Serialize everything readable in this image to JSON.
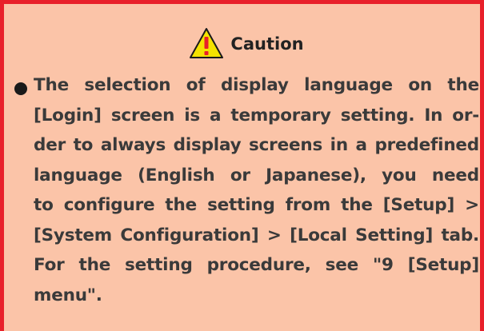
{
  "caution": {
    "title": "Caution",
    "icon": "warning-triangle-icon",
    "colors": {
      "border": "#e8202a",
      "background": "#fbc4a8",
      "icon_fill": "#f4e200",
      "text": "#3a3a3a"
    },
    "body_lines": [
      "The selection of display language on the",
      "[Login] screen is a temporary setting. In or-",
      "der to always display screens in a predefined",
      "language (English or Japanese), you need",
      "to configure the setting from the [Setup] >",
      "[System Configuration] > [Local Setting] tab.",
      "For the setting procedure, see \"9 [Setup]",
      "menu\"."
    ]
  }
}
